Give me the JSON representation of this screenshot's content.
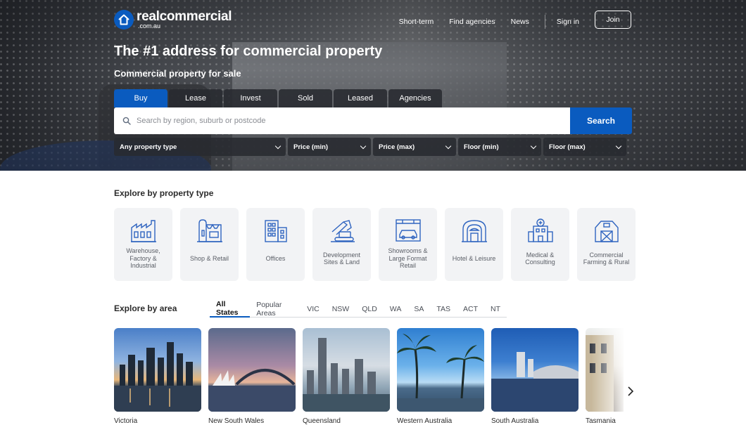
{
  "brand": {
    "name": "realcommercial",
    "sub": ".com.au"
  },
  "topnav": {
    "links": [
      "Short-term",
      "Find agencies",
      "News"
    ],
    "signin": "Sign in",
    "join": "Join"
  },
  "hero": {
    "headline": "The #1 address for commercial property",
    "subline": "Commercial property for sale",
    "tabs": [
      "Buy",
      "Lease",
      "Invest",
      "Sold",
      "Leased",
      "Agencies"
    ],
    "active_tab": "Buy",
    "search_placeholder": "Search by region, suburb or postcode",
    "search_button": "Search",
    "filters": [
      "Any property type",
      "Price (min)",
      "Price (max)",
      "Floor (min)",
      "Floor (max)"
    ]
  },
  "property_types": {
    "title": "Explore by property type",
    "items": [
      {
        "label": "Warehouse, Factory & Industrial",
        "icon": "factory-icon"
      },
      {
        "label": "Shop & Retail",
        "icon": "shop-icon"
      },
      {
        "label": "Offices",
        "icon": "office-building-icon"
      },
      {
        "label": "Development Sites & Land",
        "icon": "excavator-icon"
      },
      {
        "label": "Showrooms & Large Format Retail",
        "icon": "car-showroom-icon"
      },
      {
        "label": "Hotel & Leisure",
        "icon": "hotel-icon"
      },
      {
        "label": "Medical & Consulting",
        "icon": "medical-building-icon"
      },
      {
        "label": "Commercial Farming & Rural",
        "icon": "barn-icon"
      }
    ]
  },
  "areas": {
    "title": "Explore by area",
    "tabs": [
      "All States",
      "Popular Areas",
      "VIC",
      "NSW",
      "QLD",
      "WA",
      "SA",
      "TAS",
      "ACT",
      "NT"
    ],
    "active_tab": "All States",
    "cards": [
      {
        "name": "Victoria"
      },
      {
        "name": "New South Wales"
      },
      {
        "name": "Queensland"
      },
      {
        "name": "Western Australia"
      },
      {
        "name": "South Australia"
      },
      {
        "name": "Tasmania"
      }
    ]
  },
  "colors": {
    "brand_blue": "#0a5bbf",
    "icon_blue": "#2f64c0",
    "card_bg": "#f2f3f5"
  }
}
